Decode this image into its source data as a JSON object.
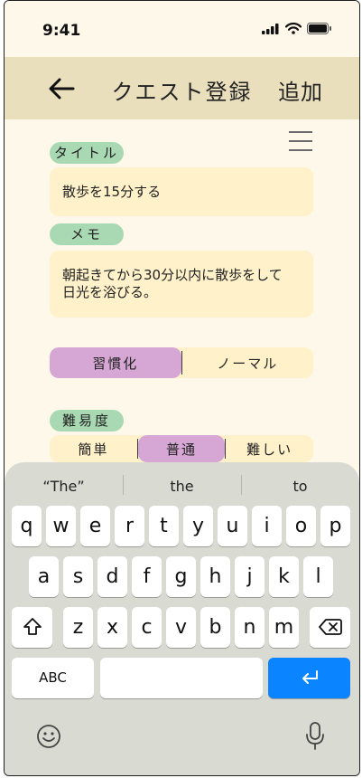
{
  "status": {
    "time": "9:41"
  },
  "header": {
    "title": "クエスト登録",
    "add_label": "追加"
  },
  "form": {
    "title_label": "タイトル",
    "title_value": "散歩を15分する",
    "memo_label": "メモ",
    "memo_line1": "朝起きてから30分以内に散歩をして",
    "memo_line2": "日光を浴びる。",
    "type_options": [
      "習慣化",
      "ノーマル"
    ],
    "type_selected": "習慣化",
    "difficulty_label": "難易度",
    "difficulty_options": [
      "簡単",
      "普通",
      "難しい"
    ],
    "difficulty_selected": "普通"
  },
  "keyboard": {
    "suggestions": [
      "“The”",
      "the",
      "to"
    ],
    "row1": [
      "q",
      "w",
      "e",
      "r",
      "t",
      "y",
      "u",
      "i",
      "o",
      "p"
    ],
    "row2": [
      "a",
      "s",
      "d",
      "f",
      "g",
      "h",
      "j",
      "k",
      "l"
    ],
    "row3": [
      "z",
      "x",
      "c",
      "v",
      "b",
      "n",
      "m"
    ],
    "abc_label": "ABC"
  },
  "colors": {
    "header": "#e9dfbd",
    "chip": "#a9d9b2",
    "selected": "#d6a6d4",
    "field": "#fff1c9",
    "return": "#0a84ff"
  }
}
